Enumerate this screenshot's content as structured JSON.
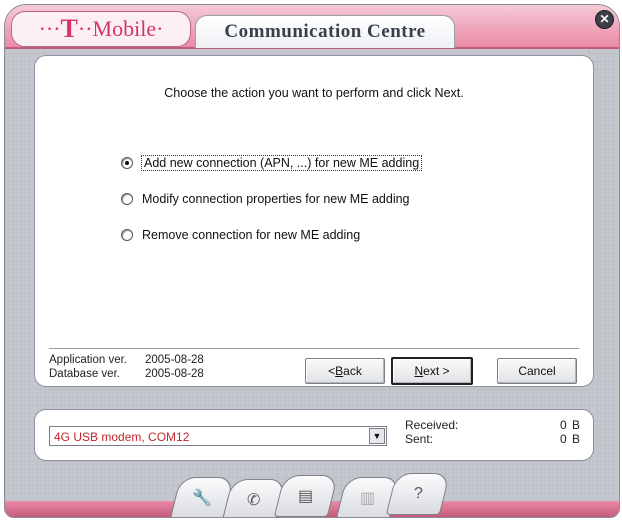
{
  "window": {
    "logo_text": "T",
    "logo_rest": "Mobile",
    "title": "Communication Centre",
    "close_glyph": "✕"
  },
  "wizard": {
    "instruction": "Choose the action you want to perform and click Next.",
    "options": [
      {
        "label": "Add new connection (APN, ...) for new ME adding",
        "selected": true
      },
      {
        "label": "Modify connection properties for new ME adding",
        "selected": false
      },
      {
        "label": "Remove connection for new ME adding",
        "selected": false
      }
    ],
    "app_version_label": "Application ver.",
    "app_version": "2005-08-28",
    "db_version_label": "Database ver.",
    "db_version": "2005-08-28",
    "back_button": {
      "prefix": "< ",
      "mnemonic": "B",
      "rest": "ack"
    },
    "next_button": {
      "mnemonic": "N",
      "rest": "ext >"
    },
    "cancel_button": "Cancel"
  },
  "status": {
    "device": "4G USB modem, COM12",
    "received_label": "Received:",
    "received_value": "0 B",
    "sent_label": "Sent:",
    "sent_value": "0 B"
  },
  "toolbar": {
    "icons": [
      "wrench-icon",
      "phone-icon",
      "sim-card-icon",
      "trash-icon",
      "help-icon"
    ],
    "help_glyph": "?"
  },
  "colors": {
    "brand_pink": "#e98aa6",
    "device_text": "#c0272d"
  }
}
